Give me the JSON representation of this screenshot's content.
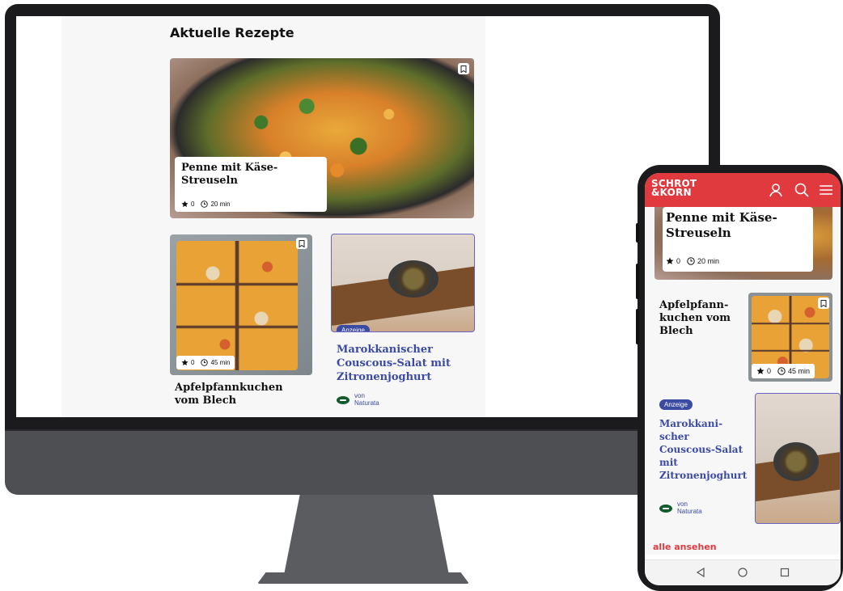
{
  "desktop": {
    "section_title": "Aktuelle Rezepte",
    "cards": [
      {
        "title_line1": "Penne mit Käse-",
        "title_line2": "Streuseln",
        "rating": "0",
        "time": "20 min"
      },
      {
        "title_line1": "Apfelpfannkuchen",
        "title_line2": "vom Blech",
        "rating": "0",
        "time": "45 min"
      },
      {
        "badge": "Anzeige",
        "title_line1": "Marokkanischer",
        "title_line2": "Couscous-Salat mit",
        "title_line3": "Zitronenjoghurt",
        "brand_prefix": "von",
        "brand_name": "Naturata"
      }
    ]
  },
  "phone": {
    "logo_line1": "SCHROT",
    "logo_line2": "&KORN",
    "cards": [
      {
        "title_line1": "Penne mit Käse-",
        "title_line2": "Streuseln",
        "rating": "0",
        "time": "20 min"
      },
      {
        "title_line1": "Apfelpfann-",
        "title_line2": "kuchen vom",
        "title_line3": "Blech",
        "rating": "0",
        "time": "45 min"
      },
      {
        "badge": "Anzeige",
        "title_line1": "Marokkani-",
        "title_line2": "scher",
        "title_line3": "Couscous-Salat",
        "title_line4": "mit",
        "title_line5": "Zitronenjoghurt",
        "brand_prefix": "von",
        "brand_name": "Naturata"
      }
    ],
    "see_all": "alle ansehen"
  },
  "colors": {
    "accent_red": "#e03a3e",
    "ad_blue": "#3b4aa3"
  },
  "icons": [
    "bookmark-icon",
    "star-icon",
    "clock-icon",
    "user-icon",
    "search-icon",
    "menu-icon",
    "back-icon",
    "home-icon",
    "recents-icon"
  ]
}
